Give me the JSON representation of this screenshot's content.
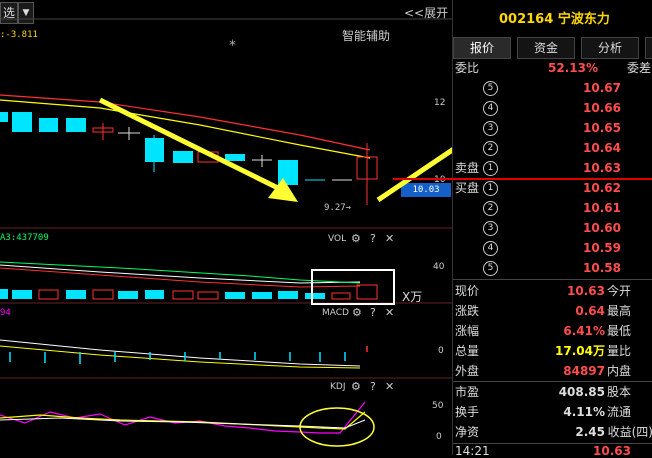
{
  "toolbar": {
    "select_label": "选",
    "dropdown_arrow": "▼",
    "expand_label": "<<展开"
  },
  "main_chart": {
    "indicator_label": ":-3.811",
    "smart_label": "智能辅助",
    "star": "*",
    "axis_top": "12",
    "axis_mid": "10",
    "low_marker": "9.27→",
    "last_price": "10.03"
  },
  "vol_panel": {
    "left_label": "A3:437709",
    "title": "VOL",
    "axis_val": "40",
    "unit": "X万"
  },
  "macd_panel": {
    "left_label": "94",
    "title": "MACD",
    "axis_val": "0"
  },
  "kdj_panel": {
    "title": "KDJ",
    "axis_top": "50",
    "axis_bottom": "0"
  },
  "panel_icons": {
    "gear": "⚙",
    "help": "?",
    "close": "✕"
  },
  "stock": {
    "code": "002164",
    "name": "宁波东力"
  },
  "tabs": [
    {
      "label": "报价"
    },
    {
      "label": "资金"
    },
    {
      "label": "分析"
    }
  ],
  "weibi": {
    "label": "委比",
    "value": "52.13%",
    "right": "委差"
  },
  "sell_orders": [
    {
      "label": "",
      "num": "5",
      "price": "10.67"
    },
    {
      "label": "",
      "num": "4",
      "price": "10.66"
    },
    {
      "label": "",
      "num": "3",
      "price": "10.65"
    },
    {
      "label": "",
      "num": "2",
      "price": "10.64"
    },
    {
      "label": "卖盘",
      "num": "1",
      "price": "10.63"
    }
  ],
  "buy_orders": [
    {
      "label": "买盘",
      "num": "1",
      "price": "10.62"
    },
    {
      "label": "",
      "num": "2",
      "price": "10.61"
    },
    {
      "label": "",
      "num": "3",
      "price": "10.60"
    },
    {
      "label": "",
      "num": "4",
      "price": "10.59"
    },
    {
      "label": "",
      "num": "5",
      "price": "10.58"
    }
  ],
  "stats": [
    {
      "label": "现价",
      "value": "10.63",
      "right": "今开",
      "color": "#ff4d4d"
    },
    {
      "label": "涨跌",
      "value": "0.64",
      "right": "最高",
      "color": "#ff4d4d"
    },
    {
      "label": "涨幅",
      "value": "6.41%",
      "right": "最低",
      "color": "#ff4d4d"
    },
    {
      "label": "总量",
      "value": "17.04万",
      "right": "量比",
      "color": "#ffff00"
    },
    {
      "label": "外盘",
      "value": "84897",
      "right": "内盘",
      "color": "#ff4d4d"
    },
    {
      "label": "市盈",
      "value": "408.85",
      "right": "股本",
      "color": "#dddddd"
    },
    {
      "label": "换手",
      "value": "4.11%",
      "right": "流通",
      "color": "#dddddd"
    },
    {
      "label": "净资",
      "value": "2.45",
      "right": "收益(四)",
      "color": "#dddddd"
    }
  ],
  "bottom_time": "14:21",
  "bottom_price": "10.63",
  "colors": {
    "up": "#ff4d4d",
    "down": "#00e5ff",
    "ma_yellow": "#ffff00",
    "ma_red": "#ff3030",
    "arrow": "#ffff33"
  }
}
